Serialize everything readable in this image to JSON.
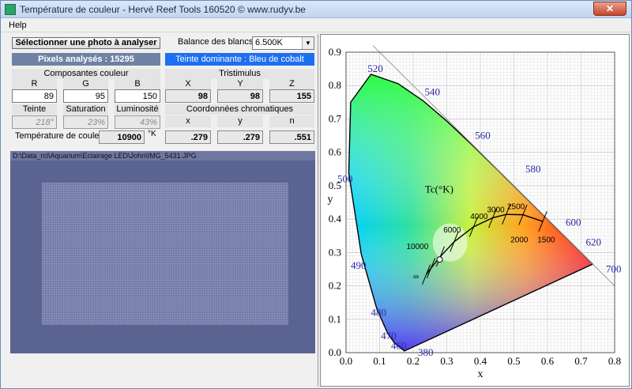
{
  "window": {
    "title": "Température de couleur - Hervé Reef Tools 160520 © www.rudyv.be",
    "close_glyph": "✕"
  },
  "menu": {
    "help": "Help"
  },
  "controls": {
    "select_photo_button": "Sélectionner une photo à analyser",
    "white_balance_label": "Balance des blancs",
    "white_balance_value": "6.500K",
    "pixels_label": "Pixels analysés :  15295",
    "dominant_tint": "Teinte dominante : Bleu de cobalt",
    "colors": {
      "pixels_bar": "#6f82a3",
      "tint_bar": "#1e6ff0"
    }
  },
  "rgb": {
    "header": "Composantes couleur",
    "r_label": "R",
    "g_label": "G",
    "b_label": "B",
    "r": "89",
    "g": "95",
    "b": "150"
  },
  "tristimulus": {
    "header": "Tristimulus",
    "x_label": "X",
    "y_label": "Y",
    "z_label": "Z",
    "x": "98",
    "y": "98",
    "z": "155"
  },
  "hsl": {
    "hue_label": "Teinte",
    "sat_label": "Saturation",
    "lum_label": "Luminosité",
    "hue": "218°",
    "sat": "23%",
    "lum": "43%"
  },
  "chroma": {
    "header": "Coordonnées chromatiques",
    "x_label": "x",
    "y_label": "y",
    "n_label": "n",
    "x": ".279",
    "y": ".279",
    "n": ".551"
  },
  "color_temp": {
    "label": "Température de couleur",
    "value": "10900",
    "unit": "°K"
  },
  "image": {
    "path": "D:\\Data_rcl\\Aquarium\\Eclairage LED\\John\\IMG_5431.JPG"
  },
  "chart_data": {
    "type": "scatter",
    "xlabel": "x",
    "ylabel": "y",
    "xlim": [
      0.0,
      0.8
    ],
    "ylim": [
      0.0,
      0.9
    ],
    "x_ticks": [
      "0.0",
      "0.1",
      "0.2",
      "0.3",
      "0.4",
      "0.5",
      "0.6",
      "0.7",
      "0.8"
    ],
    "y_ticks": [
      "0.0",
      "0.1",
      "0.2",
      "0.3",
      "0.4",
      "0.5",
      "0.6",
      "0.7",
      "0.8",
      "0.9"
    ],
    "wavelength_labels": [
      "380",
      "460",
      "470",
      "480",
      "490",
      "500",
      "520",
      "540",
      "560",
      "580",
      "600",
      "620",
      "700"
    ],
    "planckian_title": "Tc(°K)",
    "planckian_labels": [
      "∞",
      "10000",
      "6000",
      "4000",
      "3000",
      "2500",
      "2000",
      "1500"
    ],
    "measured_point": {
      "x": 0.279,
      "y": 0.279
    }
  }
}
